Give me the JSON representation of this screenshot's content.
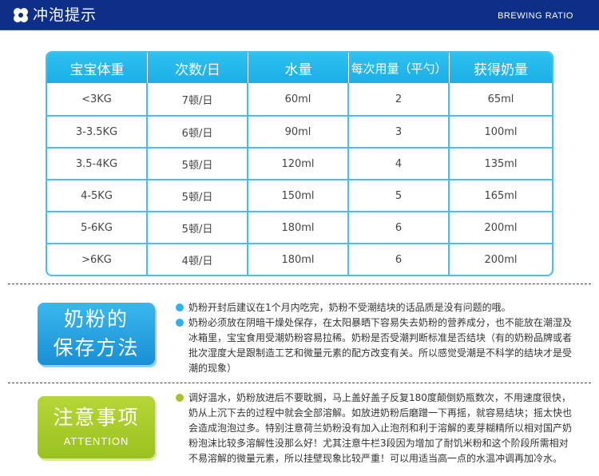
{
  "header": {
    "title": "冲泡提示",
    "subtitle": "BREWING RATIO",
    "logo_icon": "flower-logo-icon"
  },
  "table": {
    "headers": [
      "宝宝体重",
      "次数/日",
      "水量",
      "每次用量（平勺）",
      "获得奶量"
    ],
    "rows": [
      [
        "<3KG",
        "7顿/日",
        "60ml",
        "2",
        "65ml"
      ],
      [
        "3-3.5KG",
        "6顿/日",
        "90ml",
        "3",
        "100ml"
      ],
      [
        "3.5-4KG",
        "5顿/日",
        "120ml",
        "4",
        "135ml"
      ],
      [
        "4-5KG",
        "5顿/日",
        "150ml",
        "5",
        "165ml"
      ],
      [
        "5-6KG",
        "5顿/日",
        "180ml",
        "6",
        "200ml"
      ],
      [
        ">6KG",
        "4顿/日",
        "180ml",
        "6",
        "200ml"
      ]
    ]
  },
  "storage": {
    "badge_line1": "奶粉的",
    "badge_line2": "保存方法",
    "items": [
      "奶粉开封后建议在1个月内吃完，奶粉不受潮结块的话品质是没有问题的哦。",
      "奶粉必须放在阴暗干燥处保存，在太阳暴晒下容易失去奶粉的营养成分，也不能放在潮湿及冰箱里，宝宝食用受潮奶粉容易拉稀。奶粉是否受潮判断标准是否结块（有的奶粉品牌或者批次湿度大是跟制造工艺和微量元素的配方改变有关。所以感觉受潮是不科学的结块才是受潮的现象）"
    ]
  },
  "attention": {
    "badge_title": "注意事项",
    "badge_en": "ATTENTION",
    "items": [
      "调好温水，奶粉放进后不要耽搁，马上盖好盖子反复180度颠倒奶瓶数次，不用速度很快，奶从上沉下去的过程中就会全部溶解。如放进奶粉后磨蹭一下再摇，就容易结块；摇太快也会造成泡泡过多。特别注意荷兰奶粉没有加入止泡剂和利于溶解的麦芽糊精所以相对国产奶粉泡沫比较多溶解性没那么好！尤其注意牛栏3段因为增加了耐饥米粉和这个阶段所需相对不易溶解的微量元素，所以挂壁现象比较严重！可以用适当高一点的水温冲调再加冷水。"
    ]
  },
  "colors": {
    "header_bg": "#0d2f87",
    "table_accent": "#2dc2f0",
    "storage_badge": "#2a9fe0",
    "attention_badge": "#a8cb2b"
  }
}
